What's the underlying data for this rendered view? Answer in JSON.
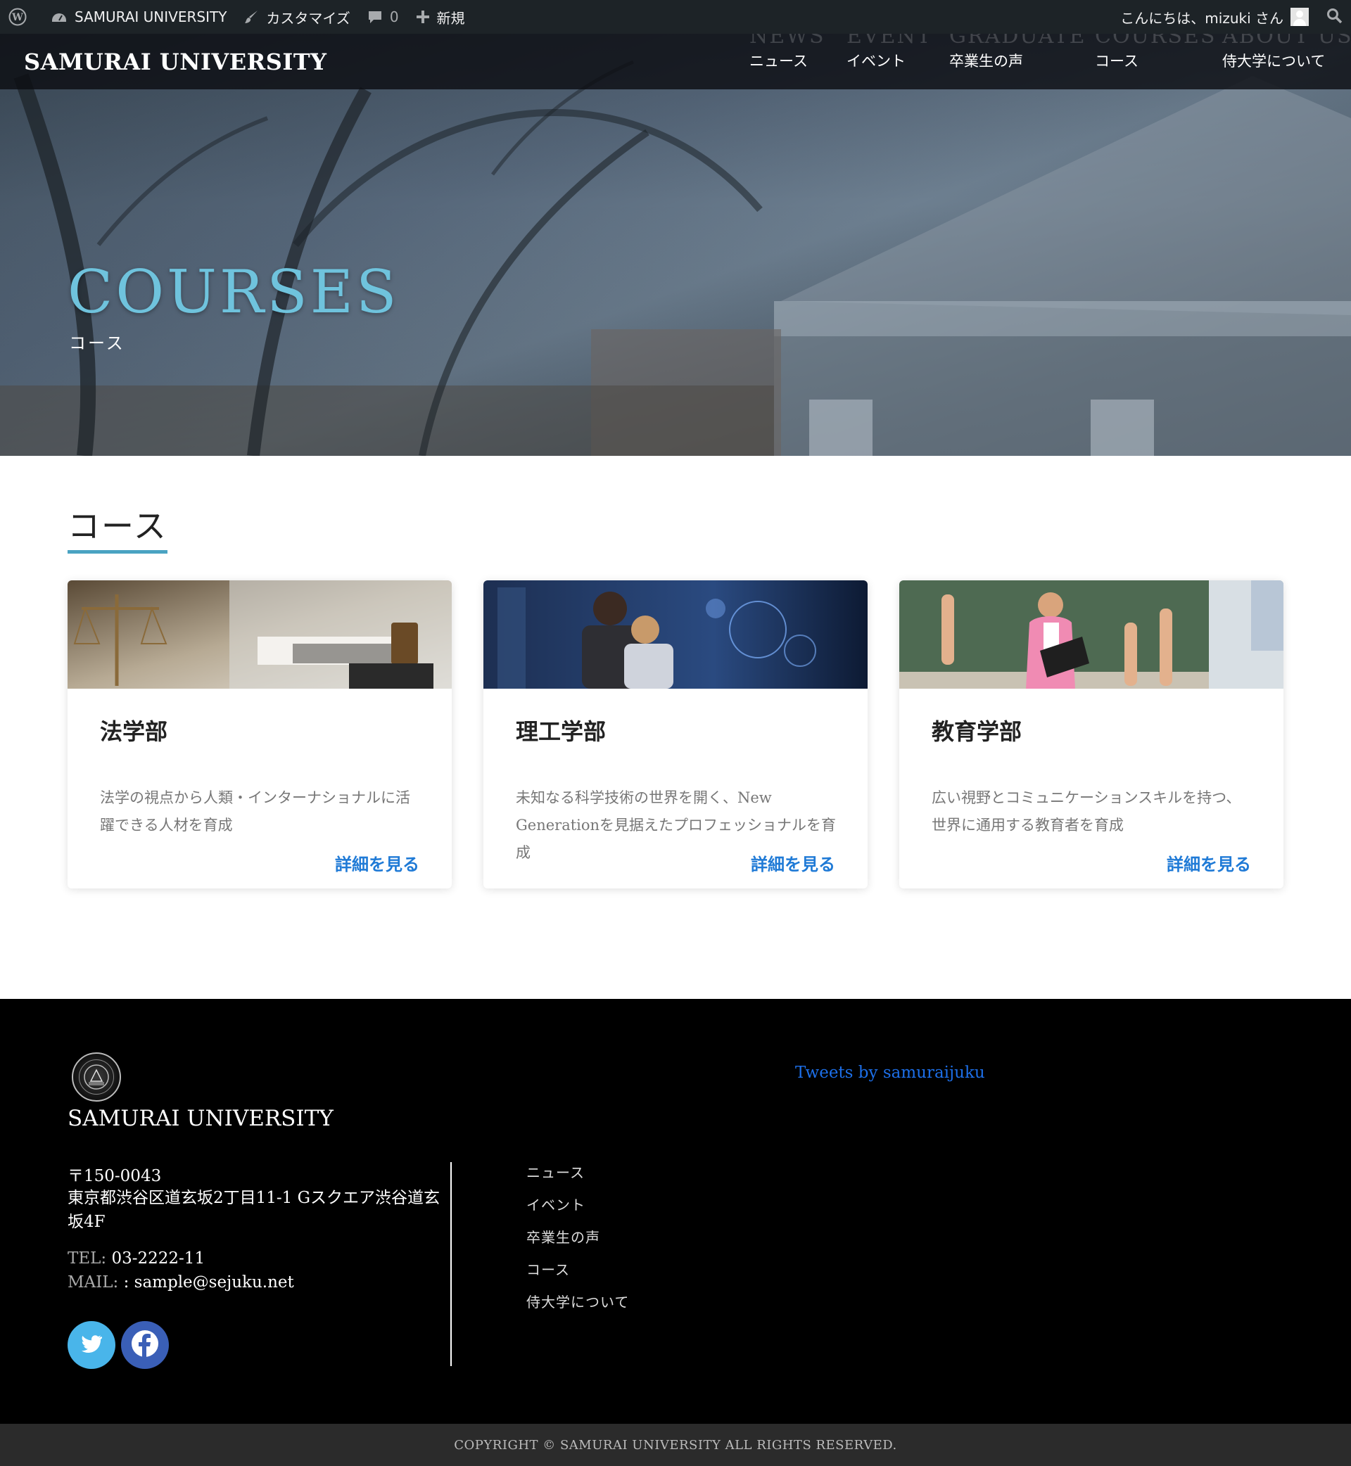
{
  "admin_bar": {
    "site_name": "SAMURAI UNIVERSITY",
    "customize": "カスタマイズ",
    "comments_count": "0",
    "new": "新規",
    "greeting": "こんにちは、mizuki さん"
  },
  "header": {
    "site_title": "SAMURAI UNIVERSITY",
    "nav": [
      {
        "en": "NEWS",
        "ja": "ニュース"
      },
      {
        "en": "EVENT",
        "ja": "イベント"
      },
      {
        "en": "GRADUATE",
        "ja": "卒業生の声"
      },
      {
        "en": "COURSES",
        "ja": "コース"
      },
      {
        "en": "ABOUT US",
        "ja": "侍大学について"
      }
    ]
  },
  "hero": {
    "title": "COURSES",
    "subtitle": "コース"
  },
  "section": {
    "heading": "コース",
    "cards": [
      {
        "title": "法学部",
        "description": "法学の視点から人類・インターナショナルに活躍できる人材を育成",
        "link": "詳細を見る",
        "image_icon": "law-scales-image"
      },
      {
        "title": "理工学部",
        "description": "未知なる科学技術の世界を開く、New Generationを見据えたプロフェッショナルを育成",
        "link": "詳細を見る",
        "image_icon": "science-tech-image"
      },
      {
        "title": "教育学部",
        "description": "広い視野とコミュニケーションスキルを持つ、世界に通用する教育者を育成",
        "link": "詳細を見る",
        "image_icon": "classroom-image"
      }
    ]
  },
  "footer": {
    "name": "SAMURAI UNIVERSITY",
    "zip": "〒150-0043",
    "address": "東京都渋谷区道玄坂2丁目11-1 Gスクエア渋谷道玄坂4F",
    "tel_label": "TEL:",
    "tel": "03-2222-11",
    "mail_label": "MAIL:",
    "mail": ": sample@sejuku.net",
    "nav": [
      "ニュース",
      "イベント",
      "卒業生の声",
      "コース",
      "侍大学について"
    ],
    "tweets": "Tweets by samuraijuku",
    "copyright": "COPYRIGHT © SAMURAI UNIVERSITY ALL RIGHTS RESERVED."
  },
  "colors": {
    "accent": "#4aa3c2",
    "hero_title": "#6fc3dd",
    "link": "#1f7ad6",
    "admin_bar": "#1d2327",
    "footer_bg": "#000000",
    "twitter": "#49b5ea",
    "facebook": "#3a5fb7"
  }
}
